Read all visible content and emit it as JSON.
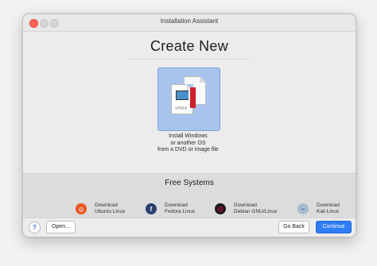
{
  "window": {
    "title": "Installation Assistant"
  },
  "create_section": {
    "title": "Create New",
    "install_tile": {
      "badge": "VHDX",
      "caption_line1": "Install Windows",
      "caption_line2": "or another OS",
      "caption_line3": "from a DVD or image file"
    }
  },
  "free_section": {
    "title": "Free Systems",
    "items": [
      {
        "line1": "Download",
        "line2": "Ubuntu Linux",
        "icon": "ubuntu-icon"
      },
      {
        "line1": "Download",
        "line2": "Fedora Linux",
        "icon": "fedora-icon"
      },
      {
        "line1": "Download",
        "line2": "Debian GNU/Linux",
        "icon": "debian-icon"
      },
      {
        "line1": "Download",
        "line2": "Kali Linux",
        "icon": "kali-icon"
      }
    ]
  },
  "footer": {
    "help_label": "?",
    "open_label": "Open...",
    "back_label": "Go Back",
    "continue_label": "Continue"
  },
  "colors": {
    "accent": "#2e7cf6",
    "tile_selected": "#a8c4ee",
    "close_button": "#ff5f57"
  }
}
